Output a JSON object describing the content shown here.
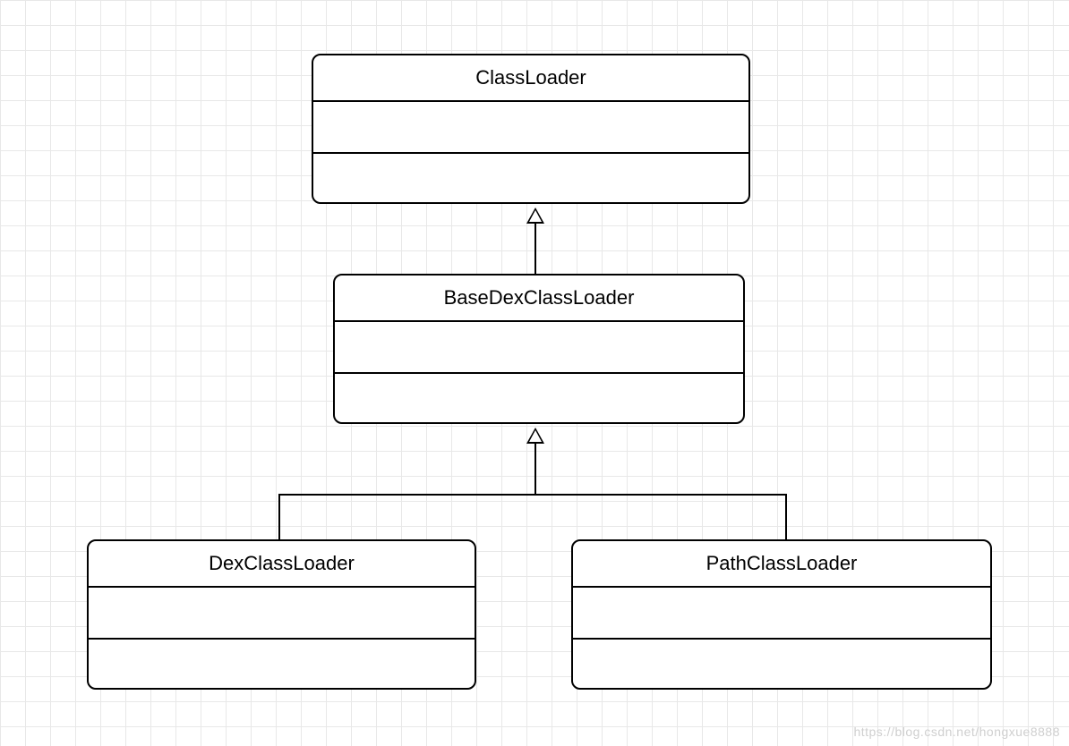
{
  "diagram": {
    "classes": {
      "classloader": {
        "name": "ClassLoader"
      },
      "basedex": {
        "name": "BaseDexClassLoader"
      },
      "dex": {
        "name": "DexClassLoader"
      },
      "path": {
        "name": "PathClassLoader"
      }
    },
    "watermark": "https://blog.csdn.net/hongxue8888"
  }
}
